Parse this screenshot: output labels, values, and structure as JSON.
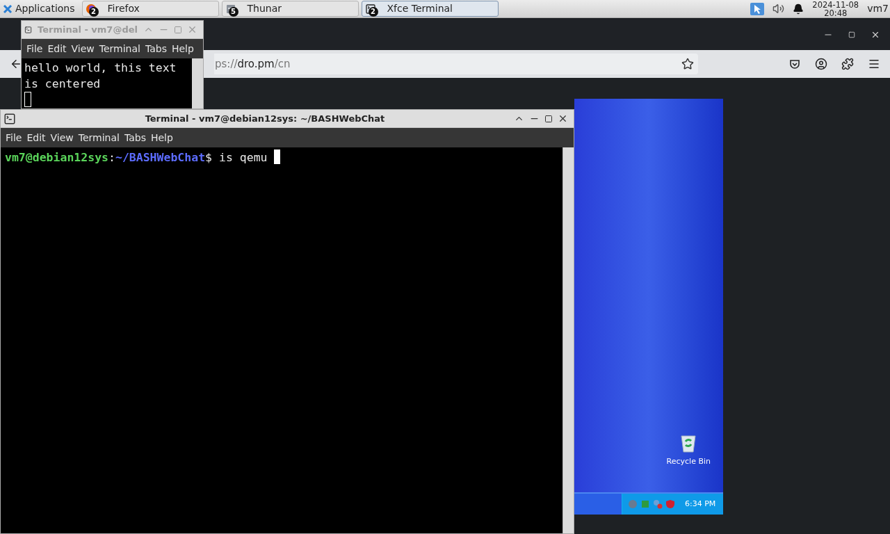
{
  "panel": {
    "menu_label": "Applications",
    "tasks": [
      {
        "kind": "browser",
        "label": "Firefox",
        "count": "2",
        "selected": false
      },
      {
        "kind": "files",
        "label": "Thunar",
        "count": "5",
        "selected": false
      },
      {
        "kind": "terminal",
        "label": "Xfce Terminal",
        "count": "2",
        "selected": true
      }
    ],
    "clock_date": "2024-11-08",
    "clock_time": "20:48",
    "user": "vm7"
  },
  "browser": {
    "url_scheme": "ps://",
    "url_host": "dro.pm",
    "url_path": "/cn"
  },
  "vm_screen": {
    "desktop_icon_label": "Recycle Bin",
    "tray_time": "6:34 PM"
  },
  "small_terminal": {
    "title": "Terminal - vm7@del",
    "active": false,
    "menu": [
      "File",
      "Edit",
      "View",
      "Terminal",
      "Tabs",
      "Help"
    ],
    "lines": [
      "hello world, this text",
      "is centered"
    ]
  },
  "main_terminal": {
    "title": "Terminal - vm7@debian12sys: ~/BASHWebChat",
    "active": true,
    "menu": [
      "File",
      "Edit",
      "View",
      "Terminal",
      "Tabs",
      "Help"
    ],
    "prompt_user": "vm7@debian12sys",
    "prompt_sep": ":",
    "prompt_path": "~/BASHWebChat",
    "prompt_sign": "$",
    "command": "is qemu"
  }
}
